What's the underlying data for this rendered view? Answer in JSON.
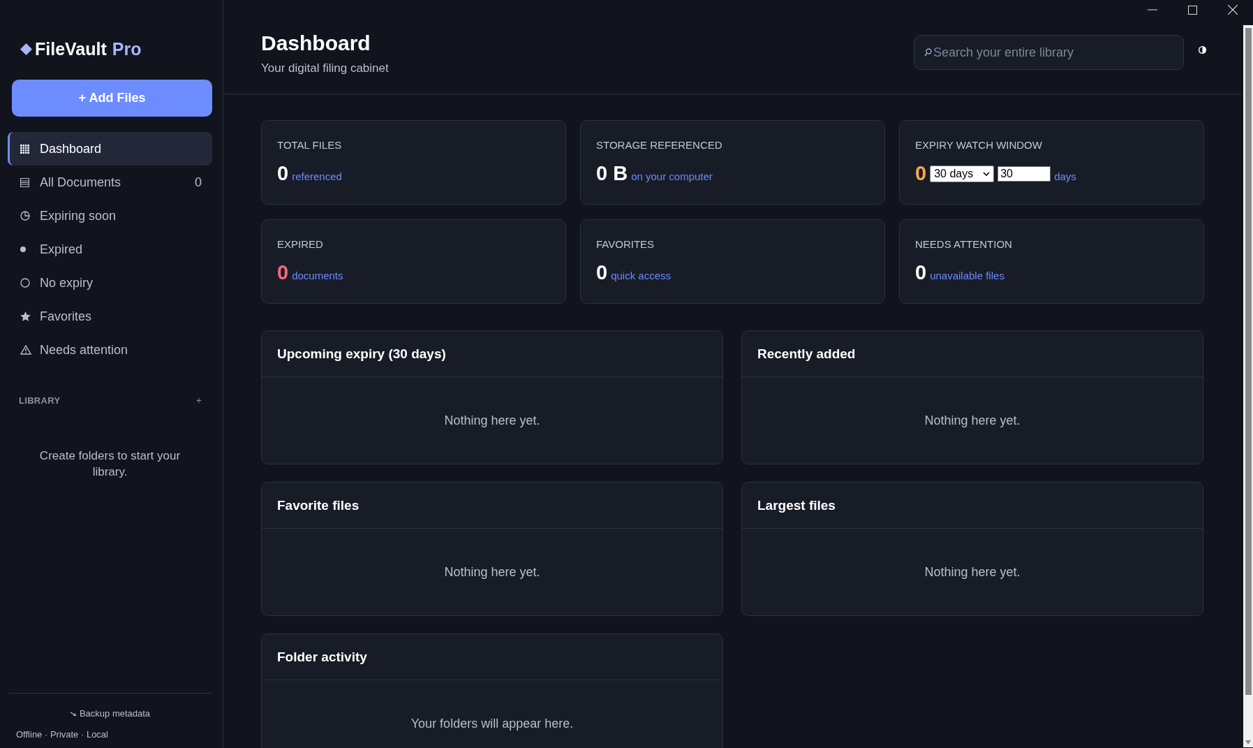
{
  "sidebar": {
    "brand": {
      "name": "FileVault",
      "suffix": "Pro"
    },
    "add_button": "+ Add Files",
    "items": [
      {
        "label": "Dashboard",
        "selected": true
      },
      {
        "label": "All Documents",
        "count": "0",
        "selected": false
      },
      {
        "label": "Expiring soon",
        "selected": false
      },
      {
        "label": "Expired",
        "selected": false
      },
      {
        "label": "No expiry",
        "selected": false
      },
      {
        "label": "Favorites",
        "selected": false
      },
      {
        "label": "Needs attention",
        "selected": false
      }
    ],
    "library": {
      "heading": "LIBRARY",
      "add": "+",
      "empty": "Create folders to start your library."
    },
    "backup": "Backup metadata",
    "footer": "Offline · Private · Local"
  },
  "header": {
    "title": "Dashboard",
    "subtitle": "Your digital filing cabinet",
    "search": {
      "placeholder": "Search your entire library"
    }
  },
  "stats": [
    {
      "kind": "plain",
      "label": "TOTAL FILES",
      "value": "0",
      "note": "referenced",
      "color": "#ffffff"
    },
    {
      "kind": "plain",
      "label": "STORAGE REFERENCED",
      "value": "0 B",
      "note": "on your computer",
      "color": "#ffffff"
    },
    {
      "kind": "window",
      "label": "EXPIRY WATCH WINDOW",
      "value": "0",
      "select": "30 days",
      "input": "30",
      "note": "days",
      "color": "#f5a84a"
    },
    {
      "kind": "plain",
      "label": "EXPIRED",
      "value": "0",
      "note": "documents",
      "color": "#f06b7a"
    },
    {
      "kind": "plain",
      "label": "FAVORITES",
      "value": "0",
      "note": "quick access",
      "color": "#ffffff"
    },
    {
      "kind": "plain",
      "label": "NEEDS ATTENTION",
      "value": "0",
      "note": "unavailable files",
      "color": "#ffffff"
    }
  ],
  "panels": [
    {
      "title": "Upcoming expiry (30 days)",
      "empty": "Nothing here yet."
    },
    {
      "title": "Recently added",
      "empty": "Nothing here yet."
    },
    {
      "title": "Favorite files",
      "empty": "Nothing here yet."
    },
    {
      "title": "Largest files",
      "empty": "Nothing here yet."
    },
    {
      "title": "Folder activity",
      "empty": "Your folders will appear here."
    }
  ]
}
